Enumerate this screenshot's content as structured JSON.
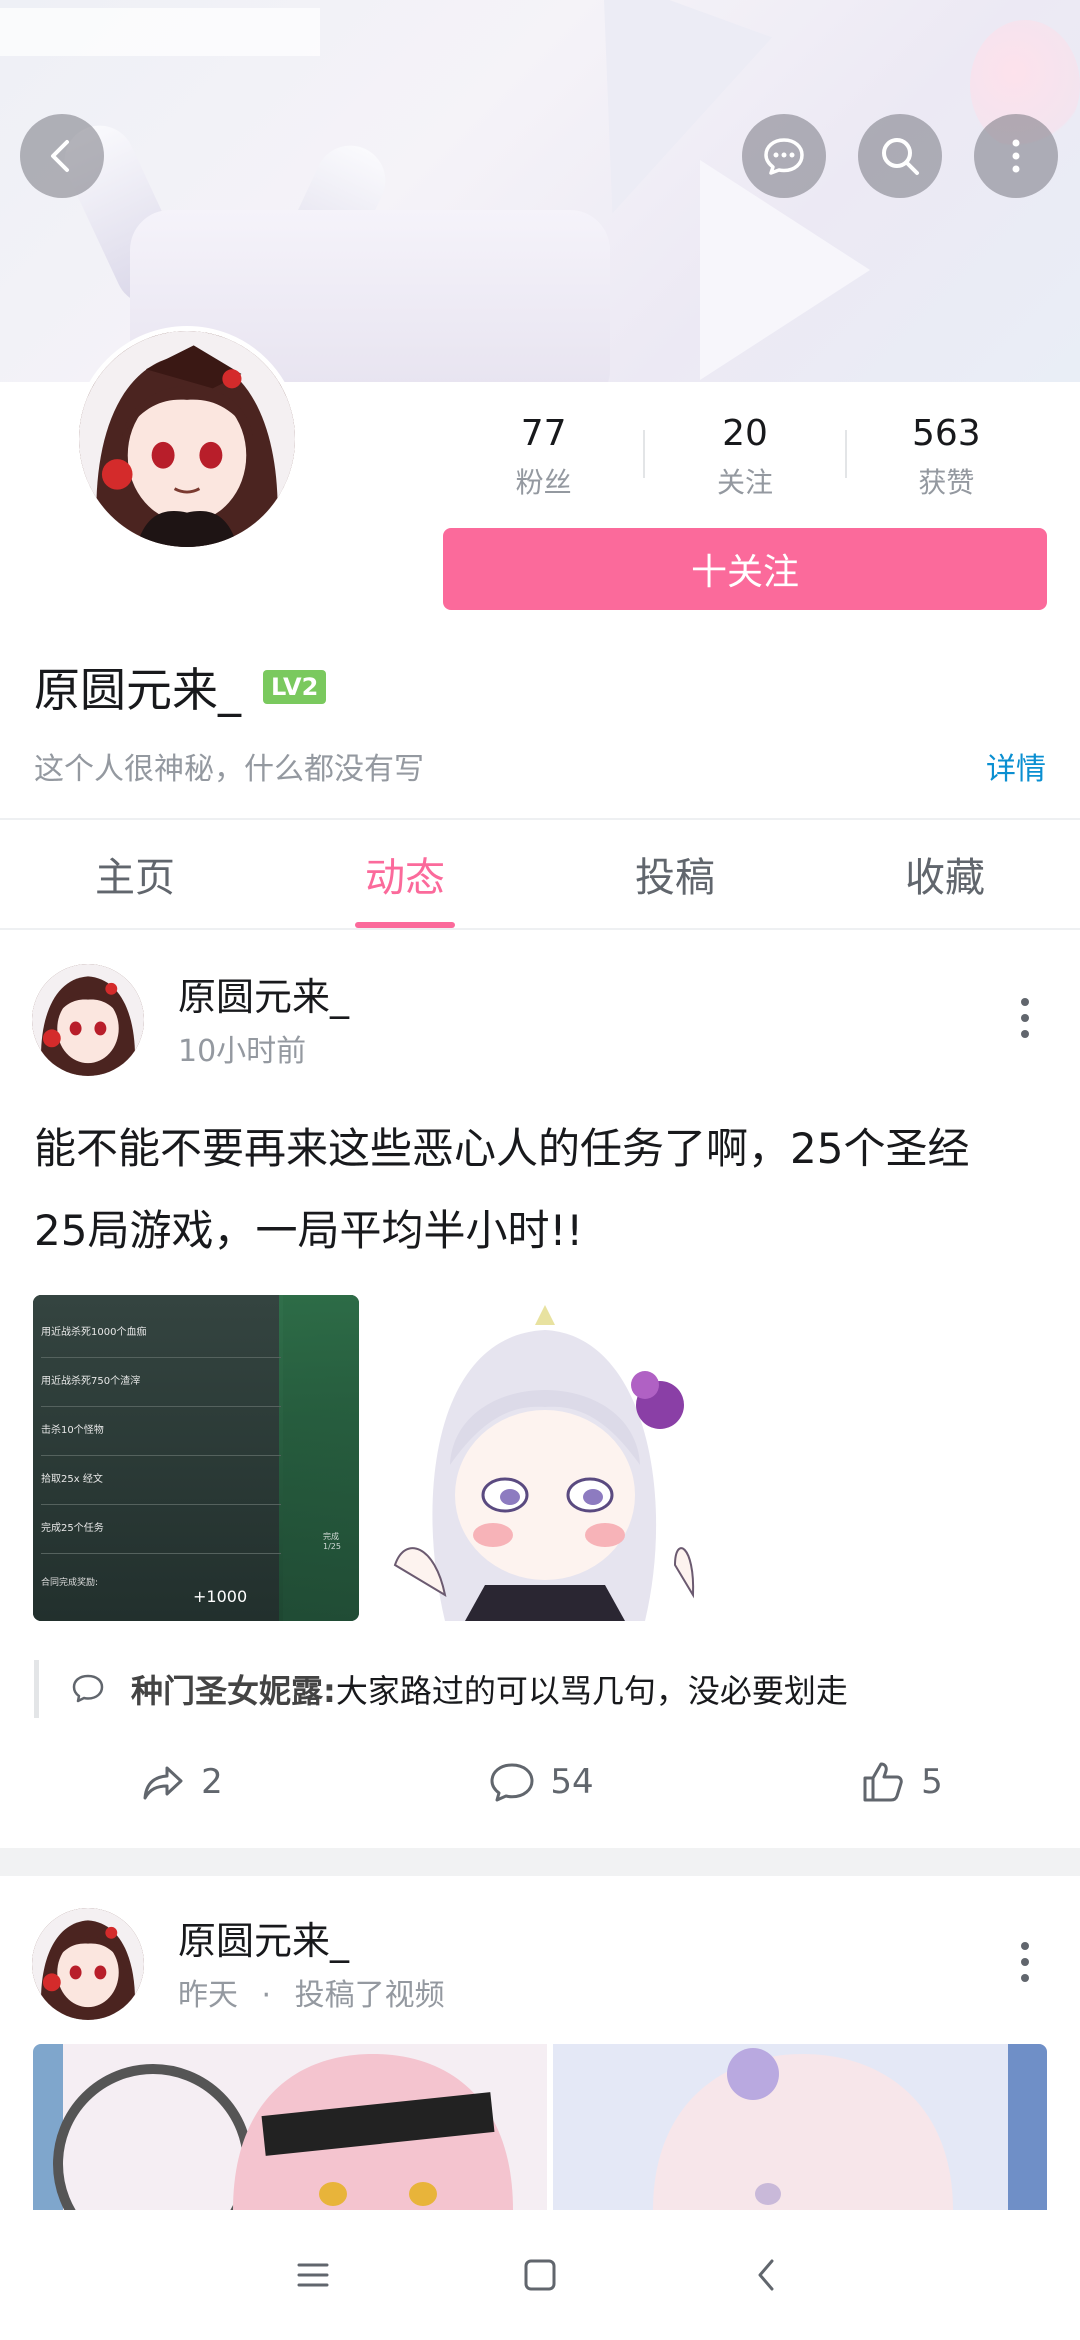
{
  "profile": {
    "name": "原圆元来_",
    "level": "LV2",
    "bio": "这个人很神秘，什么都没有写",
    "details_label": "详情",
    "follow_label": "十关注",
    "stats": [
      {
        "value": "77",
        "label": "粉丝"
      },
      {
        "value": "20",
        "label": "关注"
      },
      {
        "value": "563",
        "label": "获赞"
      }
    ]
  },
  "tabs": [
    {
      "label": "主页",
      "active": false
    },
    {
      "label": "动态",
      "active": true
    },
    {
      "label": "投稿",
      "active": false
    },
    {
      "label": "收藏",
      "active": false
    }
  ],
  "posts": [
    {
      "author": "原圆元来_",
      "time": "10小时前",
      "text_line1": "能不能不要再来这些恶心人的任务了啊，25个圣经",
      "text_line2": "25局游戏，一局平均半小时!!",
      "image1_rows": [
        "用近战杀死1000个血痂",
        "用近战杀死750个渣滓",
        "击杀10个怪物",
        "拾取25x 经文",
        "完成25个任务"
      ],
      "image1_footer": "合同完成奖励:",
      "image1_reward": "+1000",
      "image1_side": "完成 1/25",
      "comment_user": "种门圣女妮露:",
      "comment_text": "大家路过的可以骂几句，没必要划走",
      "shares": "2",
      "comments": "54",
      "likes": "5"
    },
    {
      "author": "原圆元来_",
      "time": "昨天",
      "separator": "·",
      "action": "投稿了视频"
    }
  ],
  "colors": {
    "accent": "#fb6a9b",
    "link": "#0a8fd1",
    "level_badge": "#7ac95e"
  },
  "icons": {
    "back": "chevron-left-icon",
    "message": "chat-bubble-icon",
    "search": "search-icon",
    "more": "more-vertical-icon"
  }
}
